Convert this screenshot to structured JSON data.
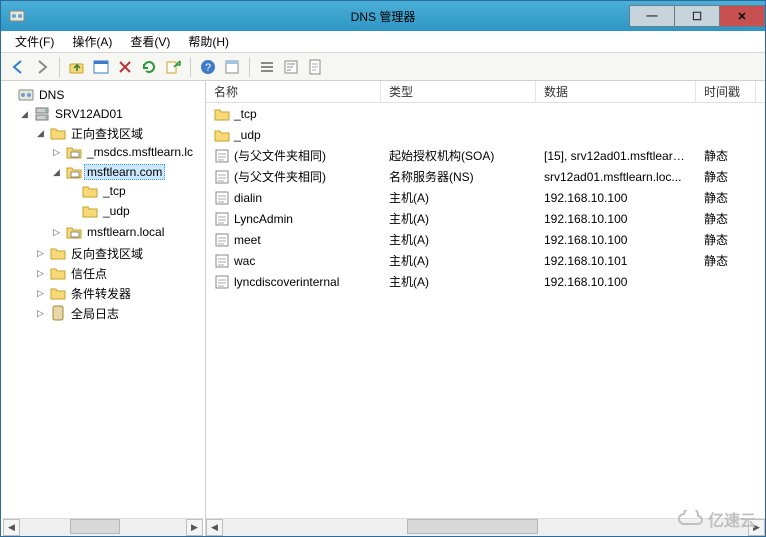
{
  "window": {
    "title": "DNS 管理器",
    "wm": {
      "min": "—",
      "max": "☐",
      "close": "✕"
    }
  },
  "menu": {
    "file": "文件(F)",
    "action": "操作(A)",
    "view": "查看(V)",
    "help": "帮助(H)"
  },
  "tree": {
    "root": "DNS",
    "server": "SRV12AD01",
    "fwd_zone": "正向查找区域",
    "z1": "_msdcs.msftlearn.lc",
    "z2": "msftlearn.com",
    "z2a": "_tcp",
    "z2b": "_udp",
    "z3": "msftlearn.local",
    "rev_zone": "反向查找区域",
    "trust": "信任点",
    "cond": "条件转发器",
    "global": "全局日志"
  },
  "columns": {
    "name": "名称",
    "type": "类型",
    "data": "数据",
    "ts": "时间戳"
  },
  "types": {
    "soa": "起始授权机构(SOA)",
    "ns": "名称服务器(NS)",
    "a": "主机(A)"
  },
  "records": [
    {
      "name": "_tcp",
      "type": "",
      "data": "",
      "ts": "",
      "icon": "folder"
    },
    {
      "name": "_udp",
      "type": "",
      "data": "",
      "ts": "",
      "icon": "folder"
    },
    {
      "name": "(与父文件夹相同)",
      "type": "soa",
      "data": "[15], srv12ad01.msftlearn...",
      "ts": "静态",
      "icon": "rec"
    },
    {
      "name": "(与父文件夹相同)",
      "type": "ns",
      "data": "srv12ad01.msftlearn.loc...",
      "ts": "静态",
      "icon": "rec"
    },
    {
      "name": "dialin",
      "type": "a",
      "data": "192.168.10.100",
      "ts": "静态",
      "icon": "rec"
    },
    {
      "name": "LyncAdmin",
      "type": "a",
      "data": "192.168.10.100",
      "ts": "静态",
      "icon": "rec"
    },
    {
      "name": "meet",
      "type": "a",
      "data": "192.168.10.100",
      "ts": "静态",
      "icon": "rec"
    },
    {
      "name": "wac",
      "type": "a",
      "data": "192.168.10.101",
      "ts": "静态",
      "icon": "rec"
    },
    {
      "name": "lyncdiscoverinternal",
      "type": "a",
      "data": "192.168.10.100",
      "ts": "",
      "icon": "rec"
    }
  ],
  "watermark": "亿速云"
}
